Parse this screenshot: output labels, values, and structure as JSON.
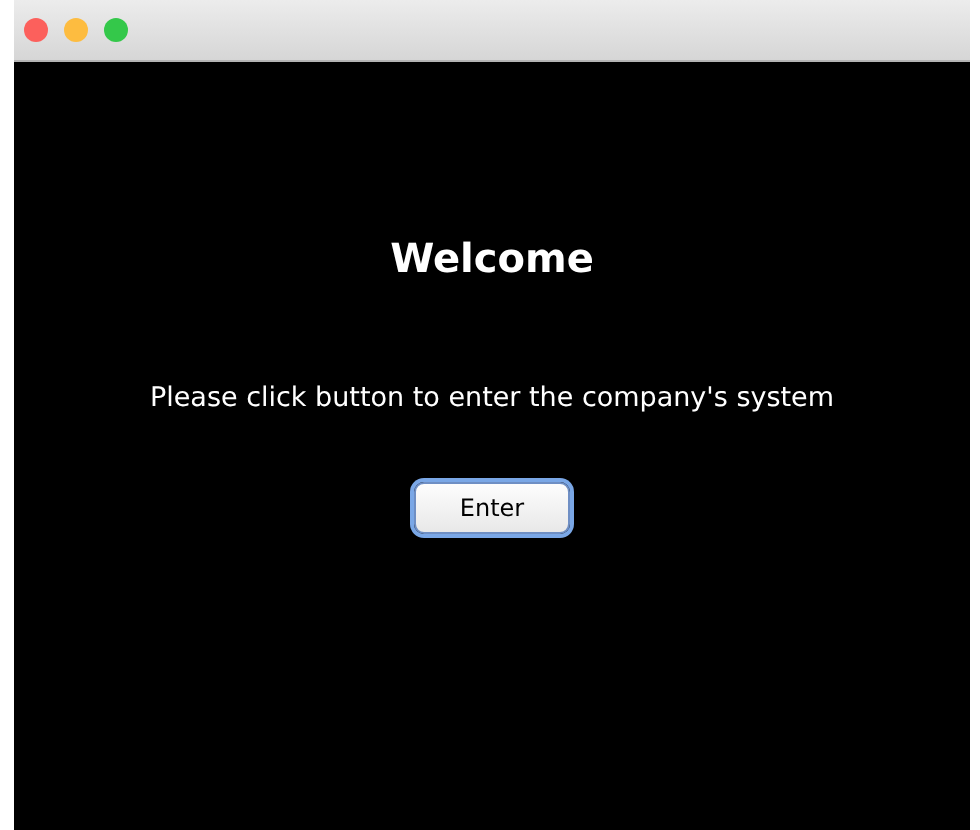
{
  "window": {
    "controls": [
      {
        "color": "#fc605c"
      },
      {
        "color": "#fdbc40"
      },
      {
        "color": "#34c84a"
      }
    ]
  },
  "heading": "Welcome",
  "message": "Please click button to enter the company's system",
  "button": {
    "label": "Enter"
  }
}
